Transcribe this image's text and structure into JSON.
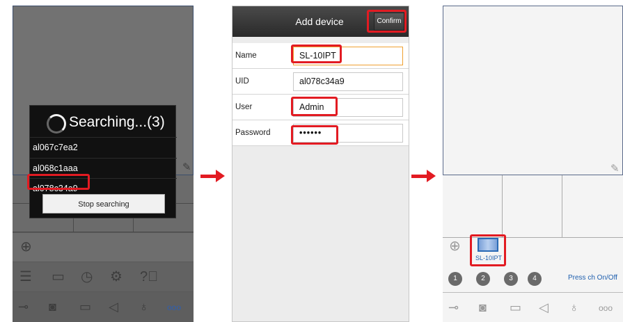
{
  "panel1": {
    "dialog": {
      "title": "Searching...(3)",
      "devices": [
        "al067c7ea2",
        "al068c1aaa",
        "al078c34a9"
      ],
      "stop_button": "Stop searching"
    }
  },
  "panel2": {
    "header_title": "Add device",
    "confirm_label": "Confirm",
    "fields": [
      {
        "label": "Name",
        "value": "SL-10IPT"
      },
      {
        "label": "UID",
        "value": "al078c34a9"
      },
      {
        "label": "User",
        "value": "Admin"
      },
      {
        "label": "Password",
        "value": "••••••"
      }
    ]
  },
  "panel3": {
    "camera_label": "SL-10IPT",
    "channels": [
      "1",
      "2",
      "3",
      "4"
    ],
    "press_hint": "Press ch On/Off",
    "more_label": "ooo"
  },
  "colors": {
    "highlight": "#e21b22",
    "link_blue": "#1f5fae",
    "dark_panel": "#6f6f6f"
  },
  "icons": {
    "panel1_toolbar1": [
      "add-icon"
    ],
    "panel1_toolbar2": [
      "list-icon",
      "folder-icon",
      "play-icon",
      "settings-icon",
      "help-icon"
    ],
    "toolbar_bottom": [
      "key-icon",
      "camera-icon",
      "video-icon",
      "speaker-icon",
      "microphone-icon",
      "more-icon"
    ]
  }
}
